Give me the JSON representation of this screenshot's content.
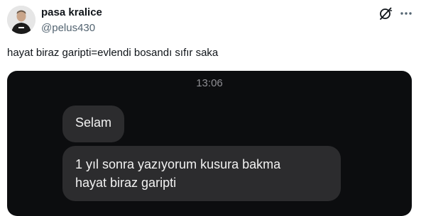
{
  "author": {
    "name": "pasa kralice",
    "handle": "@pelus430"
  },
  "tweet": {
    "text": "hayat biraz garipti=evlendi bosandı sıfır saka"
  },
  "icons": {
    "grok": "grok-icon",
    "more": "more-icon"
  },
  "chat": {
    "time": "13:06",
    "messages": [
      {
        "lines": [
          "Selam"
        ]
      },
      {
        "lines": [
          "1 yıl sonra yazıyorum kusura bakma",
          "hayat biraz garipti"
        ]
      }
    ]
  },
  "colors": {
    "chat_background": "#0c0d0f",
    "bubble": "#2c2c2e",
    "handle": "#536471"
  }
}
